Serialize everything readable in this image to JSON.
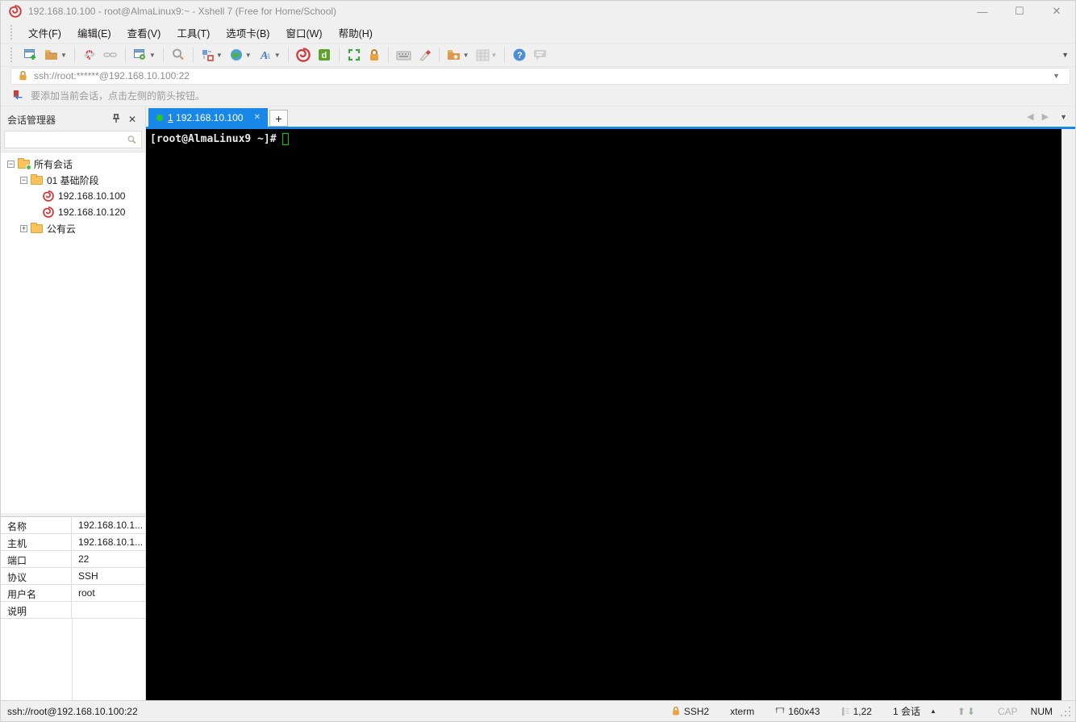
{
  "window": {
    "title": "192.168.10.100 - root@AlmaLinux9:~ - Xshell 7 (Free for Home/School)",
    "controls": {
      "minimize": "—",
      "maximize": "☐",
      "close": "✕"
    }
  },
  "menu": {
    "items": [
      "文件(F)",
      "编辑(E)",
      "查看(V)",
      "工具(T)",
      "选项卡(B)",
      "窗口(W)",
      "帮助(H)"
    ]
  },
  "toolbar": {
    "icons": [
      "new-session",
      "open-session-dropdown",
      "disconnect",
      "reconnect",
      "session-properties-dropdown",
      "find",
      "layout-dropdown",
      "web-dropdown",
      "font-dropdown",
      "xshell",
      "xftp",
      "fullscreen",
      "lock",
      "virtual-keyboard",
      "highlight-pen",
      "new-folder-dropdown",
      "matrix-dropdown",
      "help",
      "feedback"
    ]
  },
  "address_bar": {
    "value": "ssh://root:******@192.168.10.100:22"
  },
  "info_bar": {
    "message": "要添加当前会话，点击左侧的箭头按钮。"
  },
  "session_manager": {
    "title": "会话管理器",
    "tree": [
      {
        "label": "所有会话"
      },
      {
        "label": "01 基础阶段"
      },
      {
        "label": "192.168.10.100"
      },
      {
        "label": "192.168.10.120"
      },
      {
        "label": "公有云"
      }
    ],
    "properties": [
      {
        "label": "名称",
        "value": "192.168.10.1..."
      },
      {
        "label": "主机",
        "value": "192.168.10.1..."
      },
      {
        "label": "端口",
        "value": "22"
      },
      {
        "label": "协议",
        "value": "SSH"
      },
      {
        "label": "用户名",
        "value": "root"
      },
      {
        "label": "说明",
        "value": ""
      }
    ]
  },
  "tabs": {
    "active": {
      "index": "1",
      "label": "192.168.10.100",
      "close": "✕"
    },
    "new_tab": "+"
  },
  "terminal": {
    "prompt": "[root@AlmaLinux9 ~]#"
  },
  "status_bar": {
    "left": "ssh://root@192.168.10.100:22",
    "protocol": "SSH2",
    "term_type": "xterm",
    "size": "160x43",
    "cursor_pos": "1,22",
    "session_count": "1 会话",
    "cap": "CAP",
    "num": "NUM"
  },
  "colors": {
    "accent_blue": "#1987e8",
    "tab_green": "#28c828",
    "logo_red": "#d03a3a",
    "lock_orange": "#e8a33d",
    "terminal_bg": "#000000",
    "cursor_green": "#00cc00"
  }
}
